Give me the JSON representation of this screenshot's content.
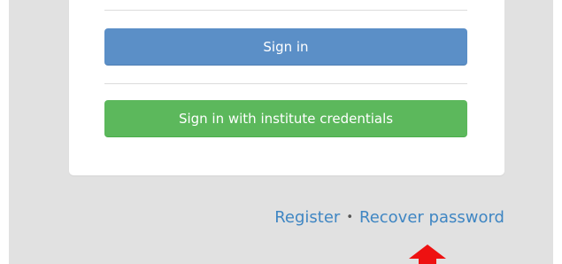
{
  "form": {
    "signin_label": "Sign in",
    "institute_label": "Sign in with institute credentials"
  },
  "footer": {
    "register_label": "Register",
    "separator": "•",
    "recover_label": "Recover password"
  },
  "annotation": {
    "arrow_icon": "red-up-arrow-icon",
    "arrow_color": "#ee1111"
  },
  "colors": {
    "background": "#e1e1e1",
    "card": "#ffffff",
    "primary_button": "#5b8fc7",
    "success_button": "#5cb85c",
    "link": "#3f86c3"
  }
}
